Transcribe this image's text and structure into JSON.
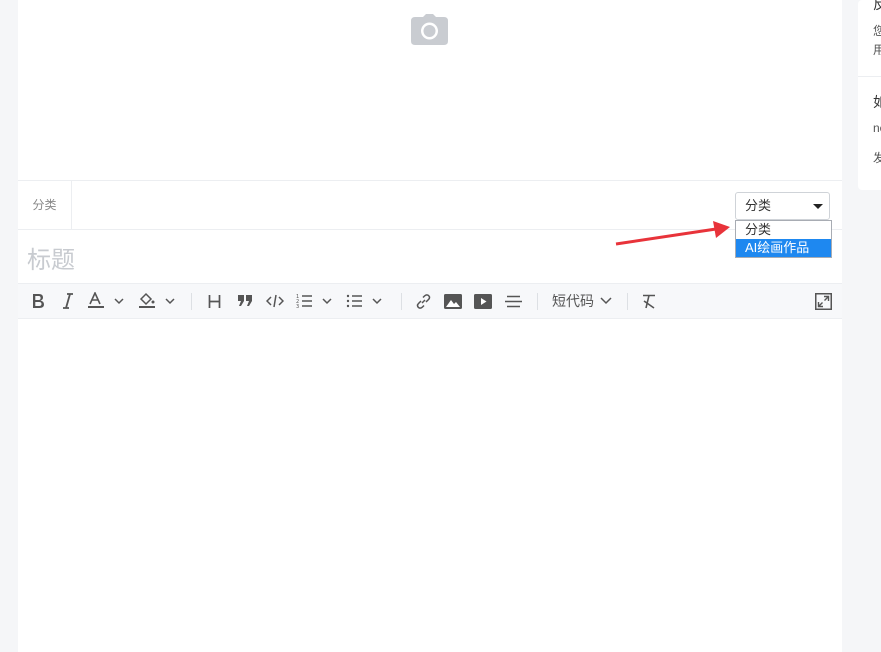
{
  "category": {
    "label": "分类",
    "selected": "分类",
    "options": [
      "分类",
      "AI绘画作品"
    ]
  },
  "title": {
    "placeholder": "标题"
  },
  "toolbar": {
    "shortcode_label": "短代码"
  },
  "right_panel": {
    "section1_title": "反",
    "section1_line1": "您",
    "section1_line2": "用",
    "section2_title": "如",
    "section2_line1": "needs",
    "section2_line2": "发"
  },
  "colors": {
    "accent": "#1e88f0",
    "annotation_arrow": "#e8333a"
  }
}
